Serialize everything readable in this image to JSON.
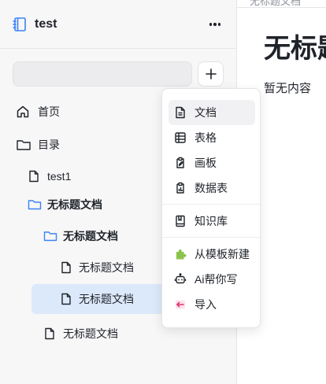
{
  "workspace": {
    "title": "test"
  },
  "search": {
    "value": "",
    "placeholder": ""
  },
  "sidebar": {
    "nav": [
      {
        "label": "首页",
        "icon": "home-icon"
      },
      {
        "label": "目录",
        "icon": "folder-icon"
      }
    ],
    "tree": [
      {
        "label": "test1",
        "icon": "file-icon",
        "level": 1
      },
      {
        "label": "无标题文档",
        "icon": "folder-icon",
        "level": 1
      },
      {
        "label": "无标题文档",
        "icon": "folder-icon",
        "level": 2
      },
      {
        "label": "无标题文档",
        "icon": "file-icon",
        "level": 3
      },
      {
        "label": "无标题文档",
        "icon": "file-icon",
        "level": 3,
        "selected": true
      },
      {
        "label": "无标题文档",
        "icon": "file-icon",
        "level": 2
      }
    ]
  },
  "main": {
    "breadcrumb": "无标题文档",
    "title": "无标题文档",
    "empty_text": "暂无内容"
  },
  "menu": {
    "items": [
      {
        "label": "文档",
        "icon": "document-icon"
      },
      {
        "label": "表格",
        "icon": "table-icon"
      },
      {
        "label": "画板",
        "icon": "whiteboard-icon"
      },
      {
        "label": "数据表",
        "icon": "datasheet-icon"
      },
      {
        "label": "知识库",
        "icon": "knowledge-base-icon"
      },
      {
        "label": "从模板新建",
        "icon": "puzzle-icon"
      },
      {
        "label": "Ai帮你写",
        "icon": "robot-icon"
      },
      {
        "label": "导入",
        "icon": "import-icon"
      }
    ]
  },
  "colors": {
    "accent": "#3b82f6",
    "selected_bg": "#dce9fb",
    "template_icon": "#8bc34a",
    "import_icon": "#e6336b"
  }
}
